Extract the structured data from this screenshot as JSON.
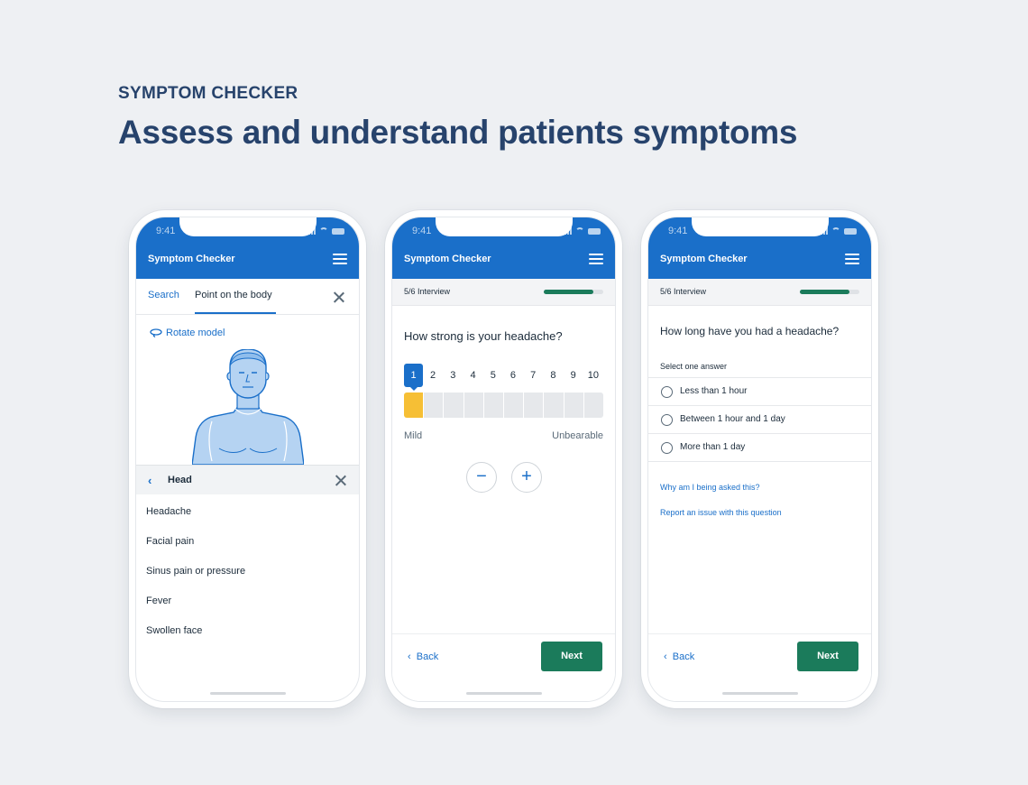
{
  "header": {
    "eyebrow": "SYMPTOM CHECKER",
    "headline": "Assess and understand patients symptoms"
  },
  "status_bar": {
    "time": "9:41"
  },
  "app": {
    "title": "Symptom Checker"
  },
  "phone1": {
    "tabs": [
      {
        "label": "Search",
        "active": false
      },
      {
        "label": "Point on the body",
        "active": true
      }
    ],
    "rotate_label": "Rotate model",
    "region": "Head",
    "symptoms": [
      "Headache",
      "Facial pain",
      "Sinus pain or pressure",
      "Fever",
      "Swollen face"
    ]
  },
  "phone2": {
    "progress_label": "5/6 Interview",
    "progress": 0.83,
    "question": "How strong is your headache?",
    "scale": [
      "1",
      "2",
      "3",
      "4",
      "5",
      "6",
      "7",
      "8",
      "9",
      "10"
    ],
    "selected": 1,
    "min_label": "Mild",
    "max_label": "Unbearable",
    "minus": "−",
    "plus": "+",
    "back": "Back",
    "next": "Next"
  },
  "phone3": {
    "progress_label": "5/6 Interview",
    "progress": 0.83,
    "question": "How long have you had a headache?",
    "hint": "Select one answer",
    "options": [
      "Less than 1 hour",
      "Between 1 hour and 1 day",
      "More than 1 day"
    ],
    "link_why": "Why am I being asked this?",
    "link_report": "Report an issue with this question",
    "back": "Back",
    "next": "Next"
  },
  "colors": {
    "primary": "#1a6fc9",
    "accent_green": "#1b7b5b",
    "scale_highlight": "#f6bf35",
    "heading": "#27436c",
    "background": "#eef0f3"
  },
  "icons": {
    "menu": "hamburger-icon",
    "close": "close-icon",
    "rotate": "rotate-icon",
    "back": "chevron-left-icon"
  }
}
